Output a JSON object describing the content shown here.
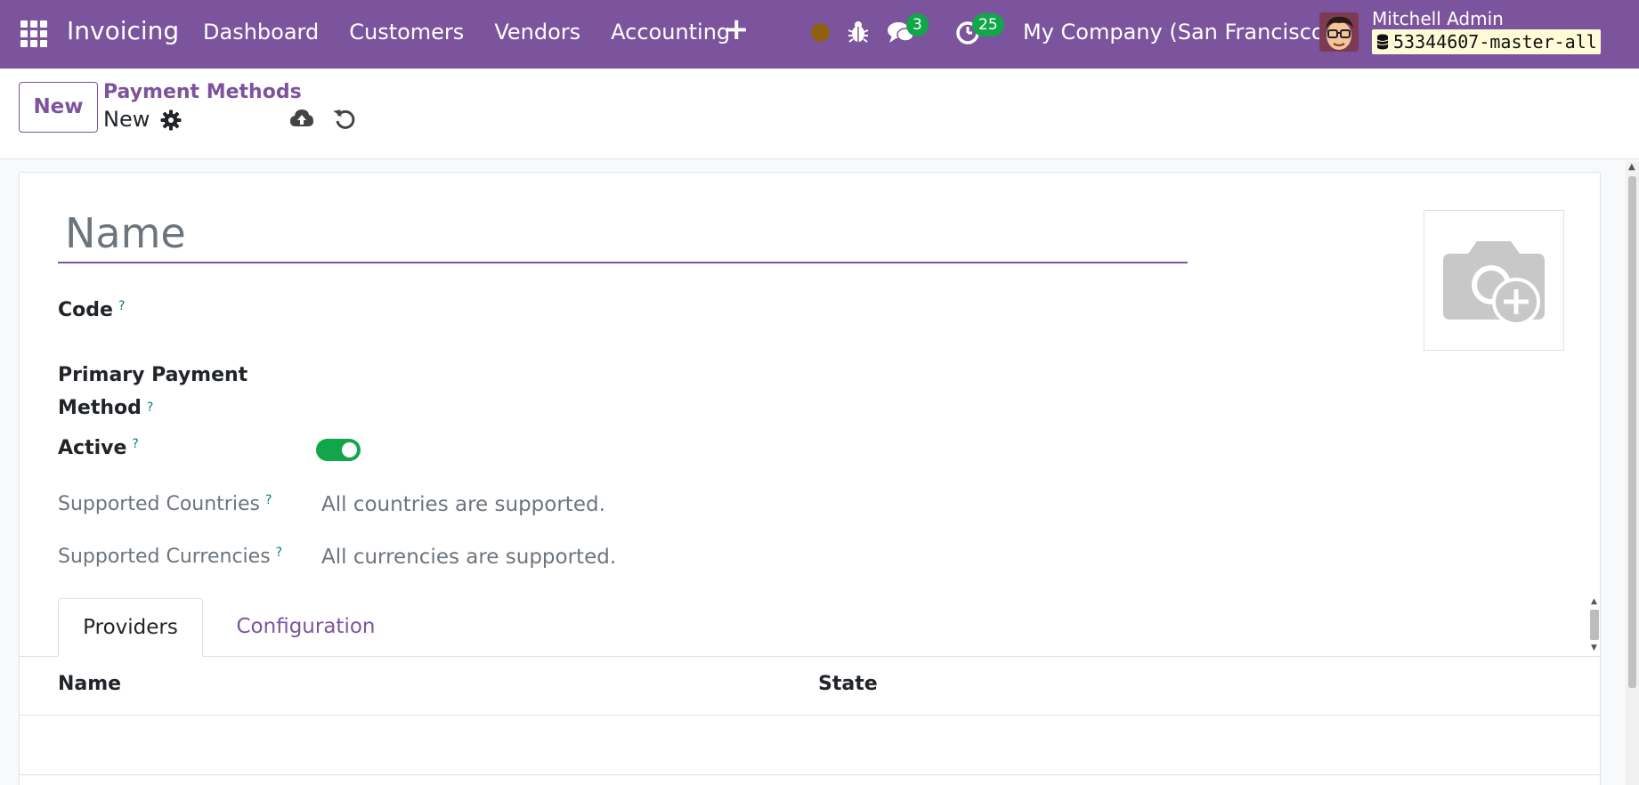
{
  "navbar": {
    "app_name": "Invoicing",
    "menu": [
      "Dashboard",
      "Customers",
      "Vendors",
      "Accounting"
    ],
    "chat_badge": "3",
    "activity_badge": "25",
    "company": "My Company (San Francisco)",
    "user_name": "Mitchell Admin",
    "database": "53344607-master-all",
    "accent_color": "#7c549d",
    "badge_color": "#12a64b"
  },
  "control_panel": {
    "new_label": "New",
    "breadcrumb_parent": "Payment Methods",
    "breadcrumb_current": "New"
  },
  "form": {
    "name_placeholder": "Name",
    "fields": {
      "code_label": "Code",
      "primary_label_line1": "Primary Payment",
      "primary_label_line2": "Method",
      "active_label": "Active",
      "active_value": true,
      "countries_label": "Supported Countries",
      "countries_value": "All countries are supported.",
      "currencies_label": "Supported Currencies",
      "currencies_value": "All currencies are supported."
    },
    "help_mark": "?"
  },
  "tabs": {
    "providers": "Providers",
    "configuration": "Configuration"
  },
  "table": {
    "columns": [
      "Name",
      "State"
    ]
  }
}
